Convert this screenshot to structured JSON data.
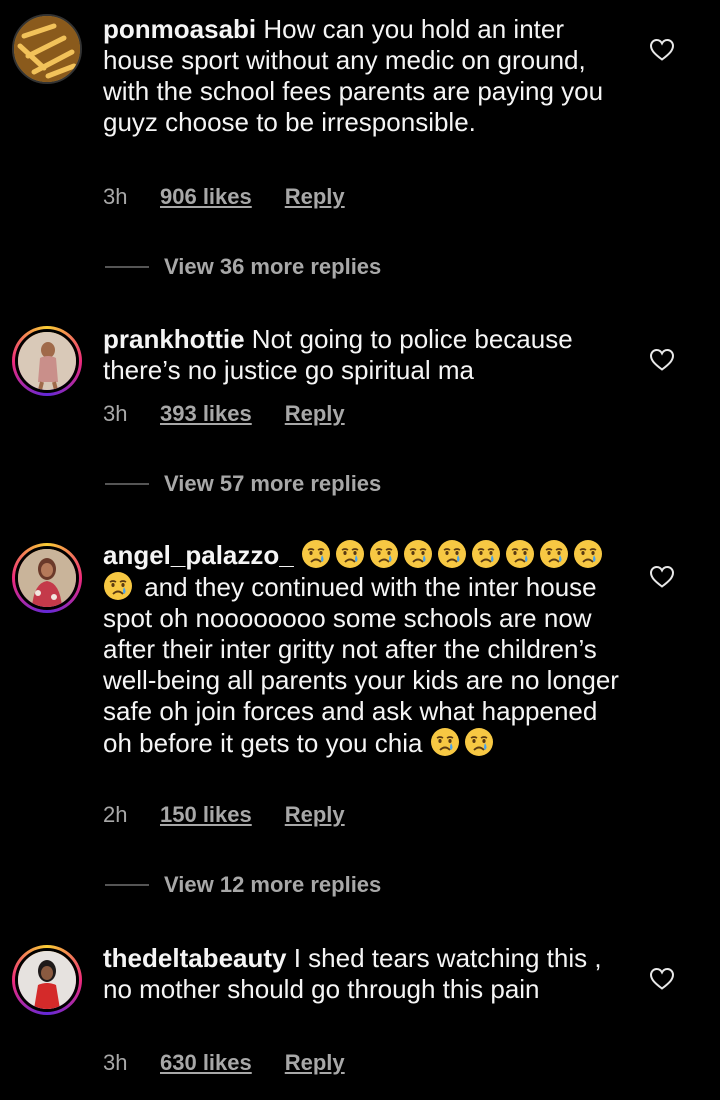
{
  "comments": [
    {
      "username": "ponmoasabi",
      "text": " How can you hold an inter house sport without any medic on ground,  with the school fees parents are paying you guyz choose to be irresponsible.",
      "time": "3h",
      "likes": "906 likes",
      "reply": "Reply",
      "view_more": "View 36 more replies",
      "avatar": "avatar-fries",
      "story_ring": false
    },
    {
      "username": "prankhottie",
      "text": " Not going to police because there’s no justice go spiritual ma",
      "time": "3h",
      "likes": "393 likes",
      "reply": "Reply",
      "view_more": "View 57 more replies",
      "avatar": "avatar-person",
      "story_ring": true
    },
    {
      "username": "angel_palazzo_",
      "text_part1": " and they continued with the inter house spot oh noooooooo some schools are now after their inter gritty not after the children’s well-being all parents your kids are no longer safe oh join forces and ask what happened oh before it gets to you chia ",
      "emoji": "crying-face-icon",
      "time": "2h",
      "likes": "150 likes",
      "reply": "Reply",
      "view_more": "View 12 more replies",
      "avatar": "avatar-person",
      "story_ring": true
    },
    {
      "username": "thedeltabeauty",
      "text": " I shed tears watching this , no mother should go through this pain",
      "time": "3h",
      "likes": "630 likes",
      "reply": "Reply",
      "avatar": "avatar-person",
      "story_ring": true
    }
  ],
  "colors": {
    "background": "#000000",
    "text": "#f5f5f5",
    "muted": "#a8a8a8",
    "story_ring": "#ee2a7b"
  }
}
